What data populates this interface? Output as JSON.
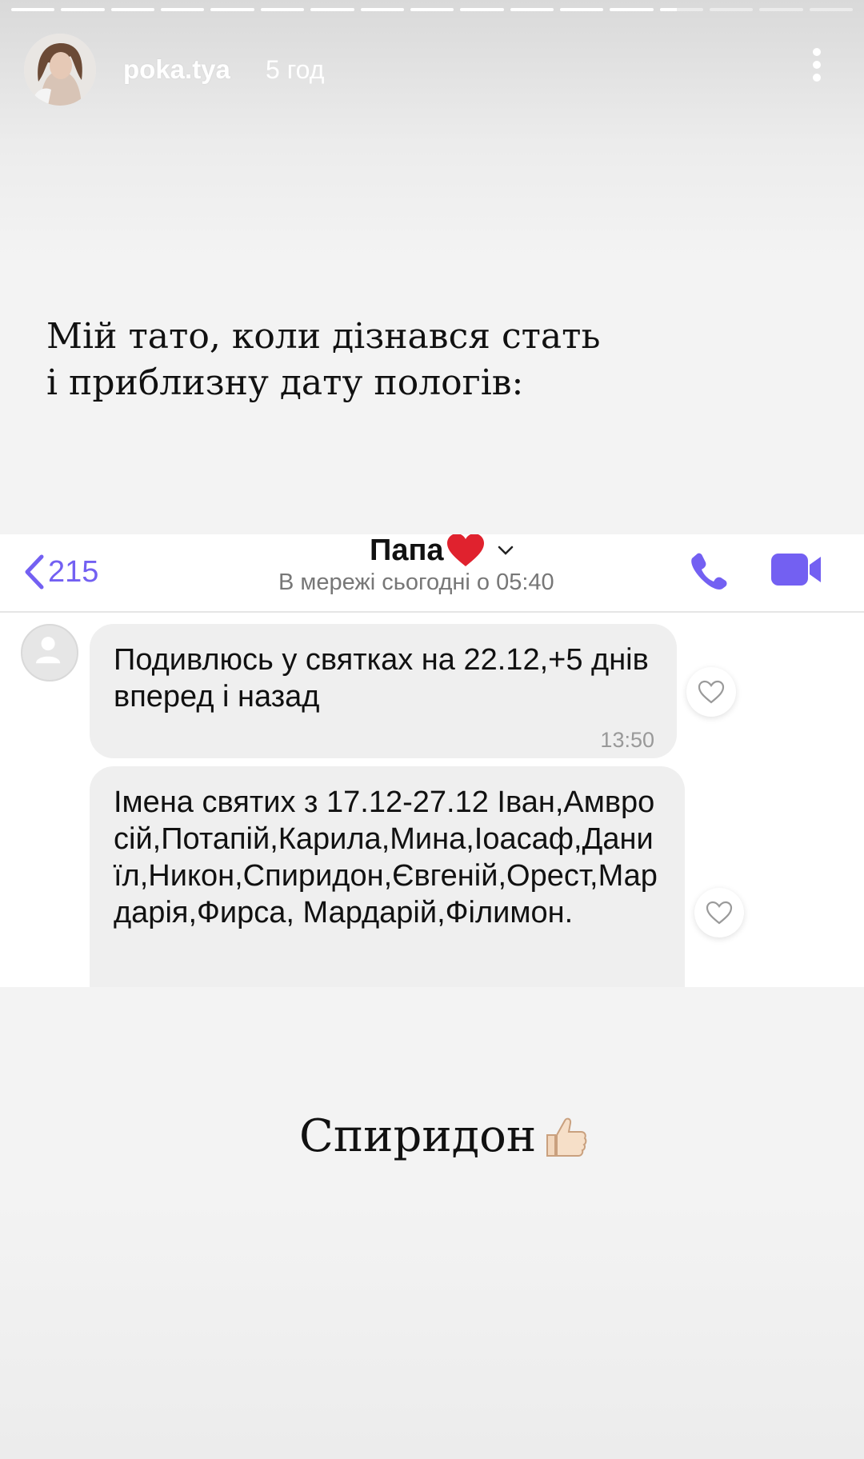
{
  "story": {
    "segments_total": 17,
    "segments_done": 13,
    "active_segment_progress": 0.4,
    "username": "poka.tya",
    "time_ago": "5 год",
    "caption": "Мій тато, коли дізнався стать і приблизну дату пологів:",
    "result_text": "Спиридон",
    "result_emoji": "thumbs-up-icon"
  },
  "chat": {
    "back_count": "215",
    "contact_name": "Папа",
    "contact_name_emoji": "red-heart-icon",
    "status": "В мережі сьогодні о 05:40",
    "accent_color": "#7360f2",
    "messages": [
      {
        "text": "Подивлюсь у святках на 22.12,+5 днів вперед і назад",
        "time": "13:50"
      },
      {
        "text": "Імена святих з 17.12-27.12 Іван,Амвросій,Потапій,Карила,Мина,Іоасаф,Даниїл,Никон,Спиридон,Євгеній,Орест,Мардарія,Фирса, Мардарій,Філимон."
      }
    ]
  }
}
